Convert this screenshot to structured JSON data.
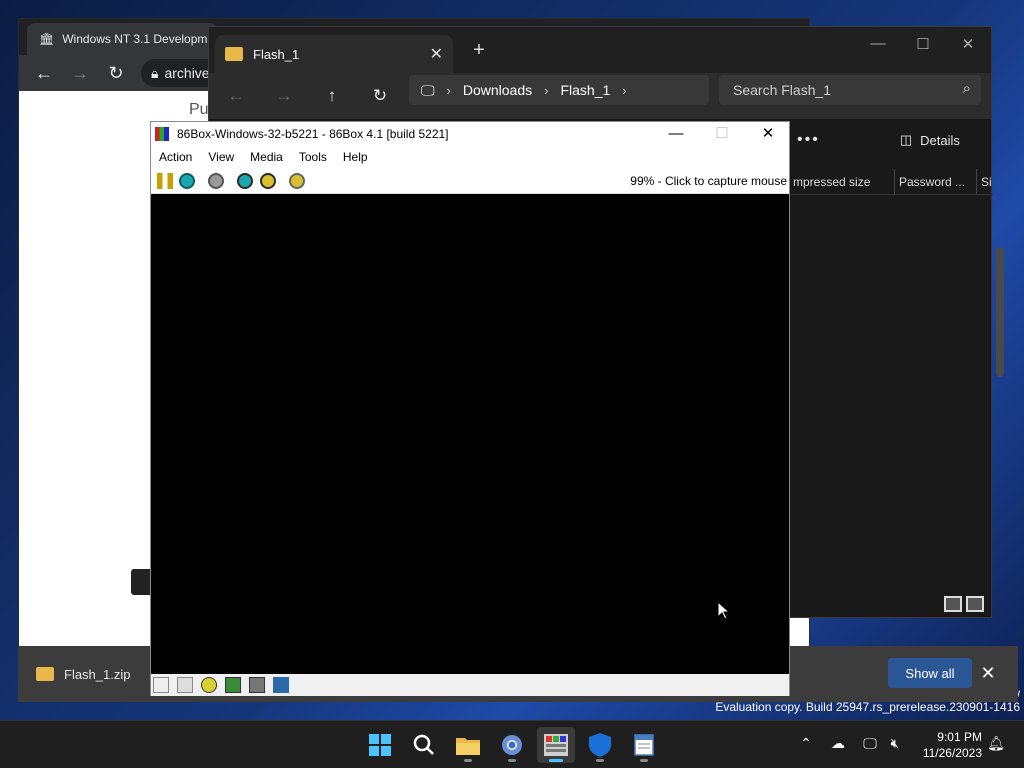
{
  "desktop": {
    "watermark_line1": "ew",
    "watermark_line2": "Evaluation copy. Build 25947.rs_prerelease.230901-1416"
  },
  "browser": {
    "tab_title": "Windows NT 3.1 Developm",
    "url": "archive.",
    "page_partial_text": "Pu"
  },
  "downloads": {
    "item_label": "Flash_1.zip",
    "show_all_label": "Show all"
  },
  "explorer": {
    "tab_title": "Flash_1",
    "breadcrumbs": [
      "Downloads",
      "Flash_1"
    ],
    "search_placeholder": "Search Flash_1",
    "more_label": "•••",
    "details_label": "Details",
    "columns": [
      "mpressed size",
      "Password ...",
      "Si"
    ]
  },
  "box86": {
    "title": "86Box-Windows-32-b5221 - 86Box 4.1 [build 5221]",
    "menu": [
      "Action",
      "View",
      "Media",
      "Tools",
      "Help"
    ],
    "status_text": "99% - Click to capture mouse"
  },
  "taskbar": {
    "time": "9:01 PM",
    "date": "11/26/2023"
  },
  "colors": {
    "accent": "#4cc2ff",
    "show_all_bg": "#2b5797",
    "folder": "#e8b84a"
  }
}
